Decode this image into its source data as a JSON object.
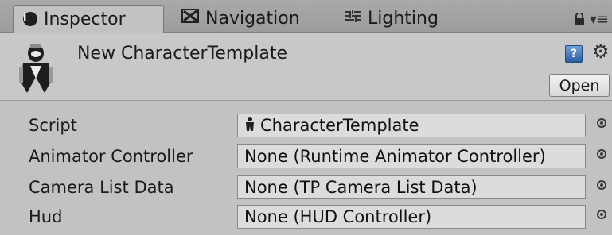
{
  "tabs": [
    {
      "label": "Inspector",
      "icon": "info-icon",
      "active": true
    },
    {
      "label": "Navigation",
      "icon": "navigation-icon",
      "active": false
    },
    {
      "label": "Lighting",
      "icon": "lighting-icon",
      "active": false
    }
  ],
  "header": {
    "title": "New CharacterTemplate",
    "open_label": "Open",
    "asset_icon": "character-template-icon"
  },
  "properties": [
    {
      "label": "Script",
      "value": "CharacterTemplate",
      "value_icon": "script-icon"
    },
    {
      "label": "Animator Controller",
      "value": "None (Runtime Animator Controller)"
    },
    {
      "label": "Camera List Data",
      "value": "None (TP Camera List Data)"
    },
    {
      "label": "Hud",
      "value": "None (HUD Controller)"
    }
  ],
  "colors": {
    "panel_bg": "#c2c2c2",
    "tab_bar_bg": "#a3a3a3",
    "field_bg": "#dcdcdc",
    "help_icon_blue": "#2a5e9e"
  }
}
